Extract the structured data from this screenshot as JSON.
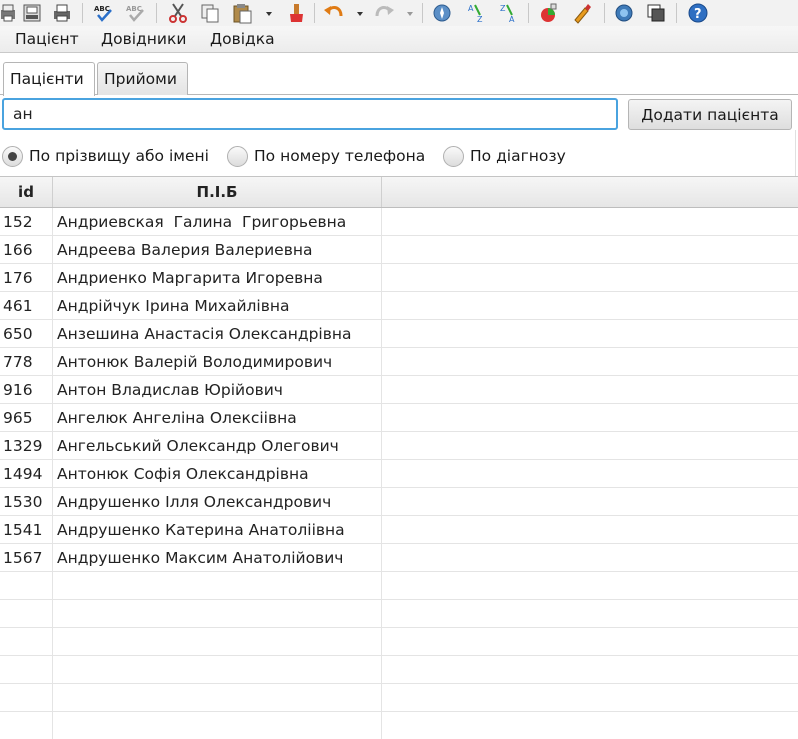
{
  "toolbar": {
    "icons": [
      "printer-preview-icon",
      "printer-icon",
      "spellcheck-icon",
      "autospellcheck-icon",
      "cut-icon",
      "copy-icon",
      "paste-icon",
      "paste-dropdown-icon",
      "clone-formatting-icon",
      "undo-icon",
      "undo-dropdown-icon",
      "redo-icon",
      "redo-dropdown-icon",
      "navigator-icon",
      "sort-ascending-icon",
      "sort-descending-icon",
      "chart-icon",
      "draw-functions-icon",
      "gallery-icon",
      "data-sources-icon",
      "help-icon"
    ]
  },
  "menu": {
    "items": [
      "Пацієнт",
      "Довідники",
      "Довідка"
    ]
  },
  "tabs": [
    {
      "label": "Пацієнти",
      "active": true
    },
    {
      "label": "Прийоми",
      "active": false
    }
  ],
  "search": {
    "value": "ан"
  },
  "add_button": {
    "label": "Додати пацієнта"
  },
  "radios": [
    {
      "label": "По прізвищу або імені",
      "selected": true
    },
    {
      "label": "По номеру телефона",
      "selected": false
    },
    {
      "label": "По діагнозу",
      "selected": false
    }
  ],
  "table": {
    "columns": [
      "id",
      "П.І.Б",
      ""
    ],
    "rows": [
      {
        "id": "152",
        "name": "Андриевская  Галина  Григорьевна"
      },
      {
        "id": "166",
        "name": "Андреева Валерия Валериевна"
      },
      {
        "id": "176",
        "name": "Андриенко Маргарита Игоревна"
      },
      {
        "id": "461",
        "name": "Андрійчук Ірина Михайлівна"
      },
      {
        "id": "650",
        "name": "Анзешина Анастасія Олександрівна"
      },
      {
        "id": "778",
        "name": "Антонюк Валерій Володимирович"
      },
      {
        "id": "916",
        "name": "Антон Владислав Юрійович"
      },
      {
        "id": "965",
        "name": "Ангелюк Ангеліна Олексіівна"
      },
      {
        "id": "1329",
        "name": "Ангельський Олександр Олегович"
      },
      {
        "id": "1494",
        "name": "Антонюк Софія Олександрівна"
      },
      {
        "id": "1530",
        "name": "Андрушенко Ілля Олександрович"
      },
      {
        "id": "1541",
        "name": "Андрушенко Катерина Анатоліівна"
      },
      {
        "id": "1567",
        "name": "Андрушенко Максим Анатолійович"
      }
    ]
  },
  "colors": {
    "focus_border": "#4aa3df"
  }
}
